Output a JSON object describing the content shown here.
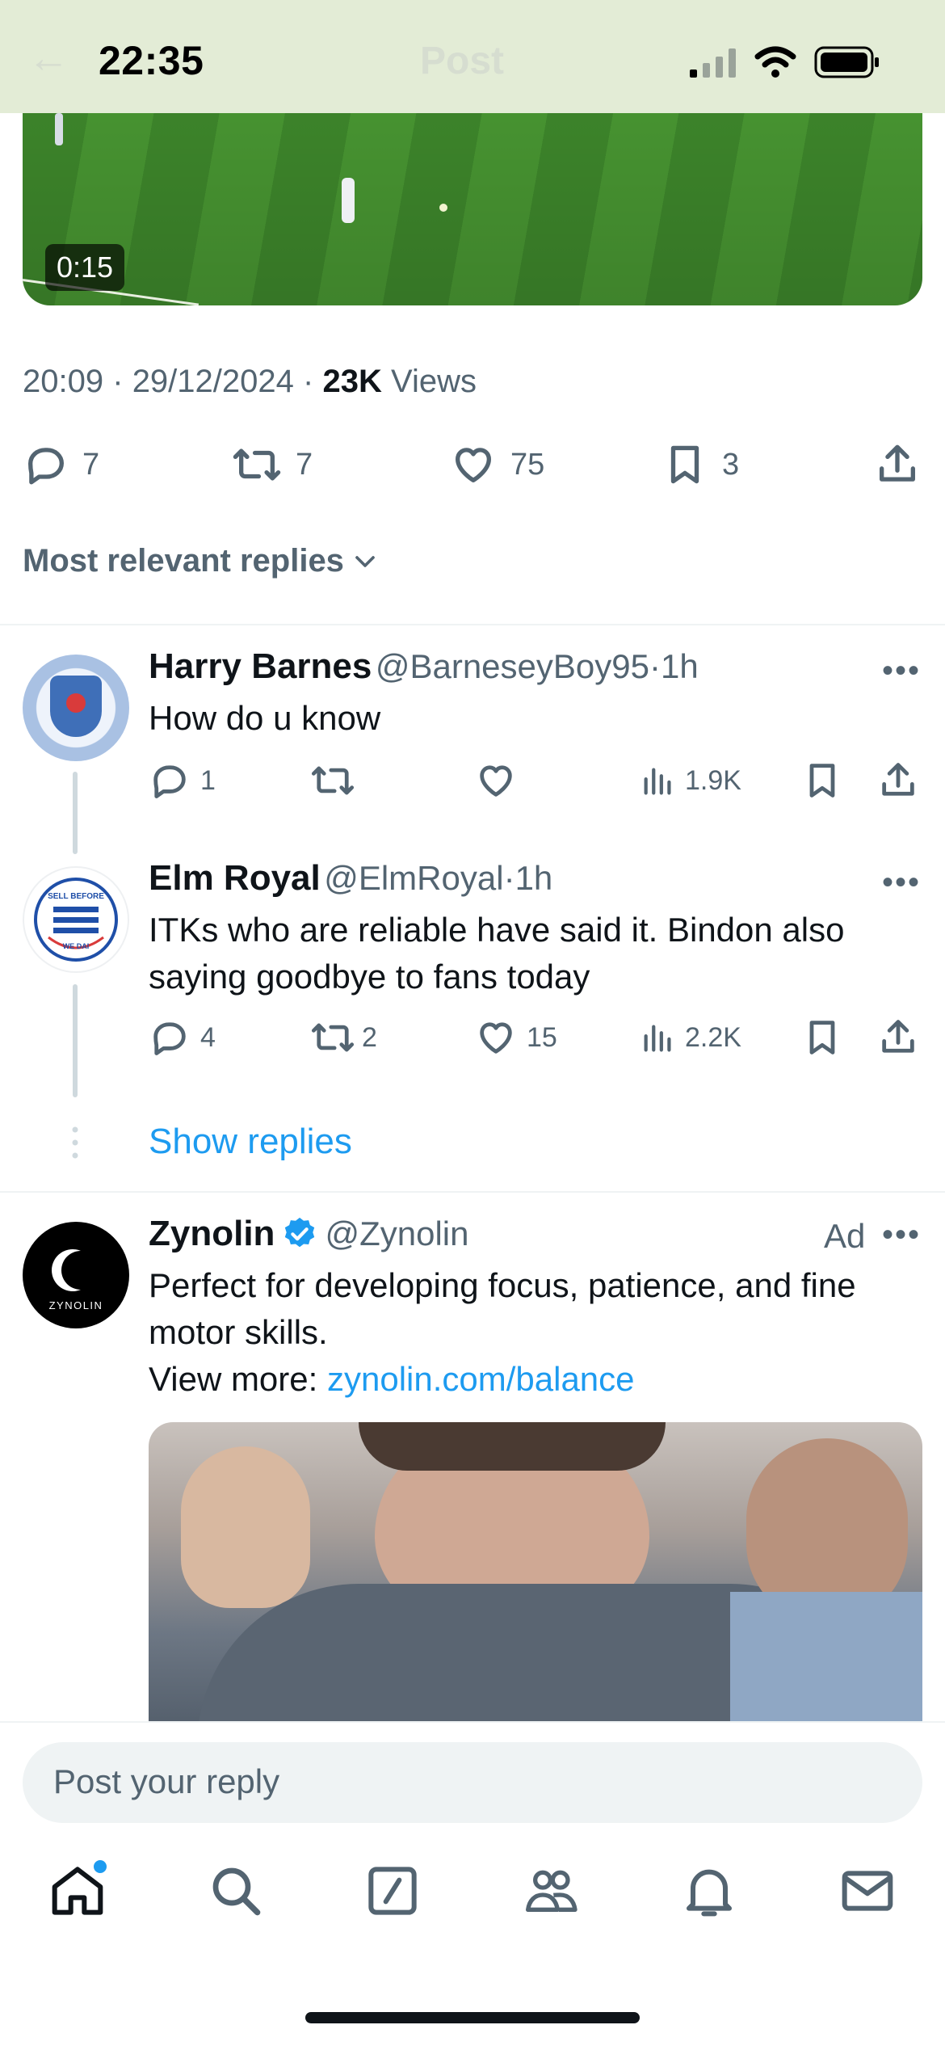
{
  "status_bar": {
    "time": "22:35"
  },
  "header": {
    "title": "Post"
  },
  "media": {
    "duration": "0:15"
  },
  "post": {
    "time": "20:09",
    "date": "29/12/2024",
    "views_count": "23K",
    "views_label": "Views",
    "sep": "·",
    "replies": "7",
    "reposts": "7",
    "likes": "75",
    "bookmarks": "3"
  },
  "sort": {
    "label": "Most relevant replies"
  },
  "replies": [
    {
      "name": "Harry Barnes",
      "handle": "@BarneseyBoy95",
      "time": "1h",
      "sep": "·",
      "text": "How do u know",
      "replies": "1",
      "reposts": "",
      "likes": "",
      "views": "1.9K"
    },
    {
      "name": "Elm Royal",
      "handle": "@ElmRoyal",
      "time": "1h",
      "sep": "·",
      "text": "ITKs who are reliable have said it. Bindon also saying goodbye to fans today",
      "replies": "4",
      "reposts": "2",
      "likes": "15",
      "views": "2.2K",
      "avatar_text_top": "SELL BEFORE",
      "avatar_text_bottom": "WE DAI"
    }
  ],
  "show_replies": "Show replies",
  "ad": {
    "name": "Zynolin",
    "handle": "@Zynolin",
    "ad_label": "Ad",
    "text": "Perfect for developing focus, patience, and fine motor skills.",
    "view_more_label": "View more:",
    "link": "zynolin.com/balance",
    "avatar_text": "ZYNOLIN"
  },
  "composer": {
    "placeholder": "Post your reply"
  },
  "colors": {
    "accent": "#1d9bf0",
    "secondary_text": "#536471",
    "status_bg": "#e3ecd6"
  }
}
